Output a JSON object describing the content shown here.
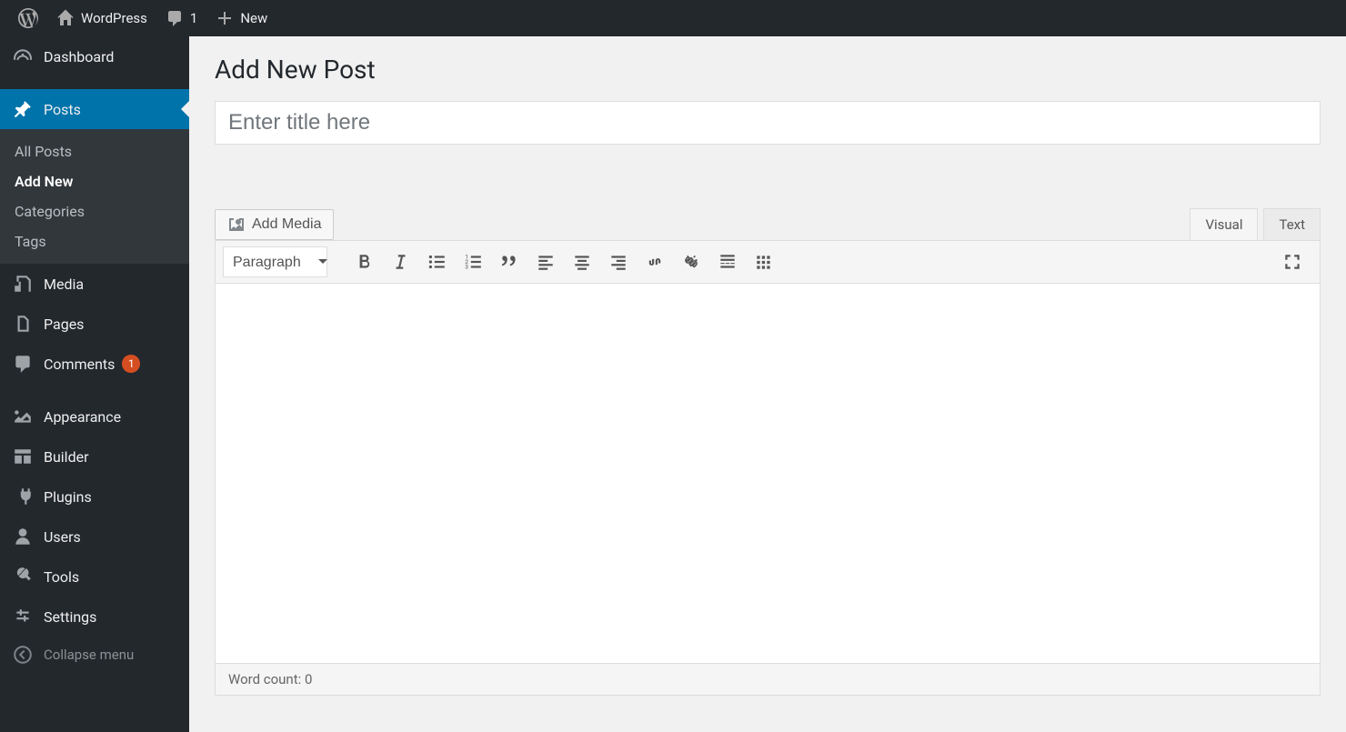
{
  "adminbar": {
    "site_name": "WordPress",
    "comment_count": "1",
    "new_label": "New"
  },
  "sidebar": {
    "dashboard": "Dashboard",
    "posts": "Posts",
    "posts_submenu": {
      "all_posts": "All Posts",
      "add_new": "Add New",
      "categories": "Categories",
      "tags": "Tags"
    },
    "media": "Media",
    "pages": "Pages",
    "comments": "Comments",
    "comments_badge": "1",
    "appearance": "Appearance",
    "builder": "Builder",
    "plugins": "Plugins",
    "users": "Users",
    "tools": "Tools",
    "settings": "Settings",
    "collapse": "Collapse menu"
  },
  "page": {
    "title": "Add New Post",
    "title_placeholder": "Enter title here"
  },
  "editor": {
    "add_media": "Add Media",
    "tab_visual": "Visual",
    "tab_text": "Text",
    "format_select": "Paragraph",
    "word_count_label": "Word count: ",
    "word_count": "0"
  }
}
